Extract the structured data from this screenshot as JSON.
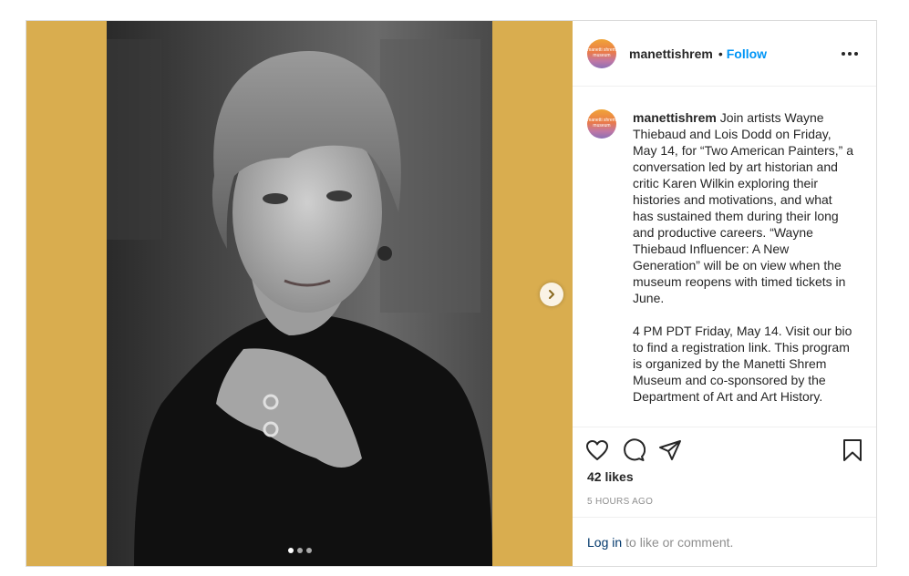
{
  "post": {
    "username": "manettishrem",
    "follow_label": "Follow",
    "avatar_text_top": "manetti shrem",
    "avatar_text_bottom": "museum",
    "caption_paragraphs": [
      "Join artists Wayne Thiebaud and Lois Dodd on Friday, May 14, for “Two American Painters,” a conversation led by art historian and critic Karen Wilkin exploring their histories and motivations, and what has sustained them during their long and productive careers. “Wayne Thiebaud Influencer: A New Generation” will be on view when the museum reopens with timed tickets in June.",
      "4 PM PDT Friday, May 14. Visit our bio to find a registration link. This program is organized by the Manetti Shrem Museum and co-sponsored by the Department of Art and Art History."
    ],
    "likes": "42 likes",
    "timestamp": "5 HOURS AGO",
    "login_link": "Log in",
    "comment_prompt": "to like or comment.",
    "carousel": {
      "total_slides": 3,
      "active_slide": 1
    },
    "colors": {
      "media_background": "#d9ad4f",
      "link_blue": "#0095f6"
    }
  }
}
